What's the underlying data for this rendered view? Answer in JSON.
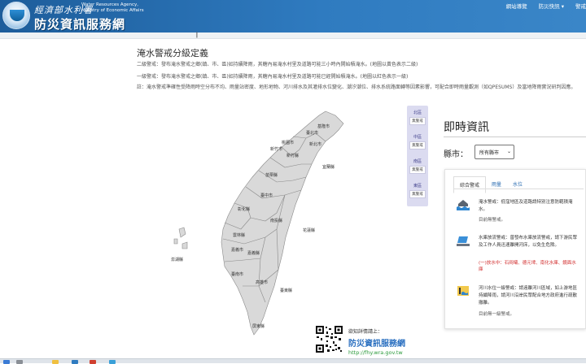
{
  "header": {
    "agency_zh": "經濟部水利署",
    "agency_en_1": "Water Resources Agency,",
    "agency_en_2": "Ministry of Economic Affairs",
    "site_title": "防災資訊服務網",
    "nav": [
      "網站導覽",
      "防災快訊 ▾",
      "警戒"
    ]
  },
  "subbar": {
    "glyph": "┃"
  },
  "definition": {
    "title": "淹水警戒分級定義",
    "level2": "二級警戒：發布淹水警戒之鄉(鎮、市、區)如持續降雨，其轄內易淹水村里及道路可能三小時內開始積淹水。(地圖以黃色表示二級)",
    "level1": "一級警戒：發布淹水警戒之鄉(鎮、市、區)如持續降雨，其轄內易淹水村里及道路可能已經開始積淹水。(地圖以紅色表示一級)",
    "note": "註：淹水警戒準確性受降雨時空分布不均、雨量站密度、地形地物、河川排水及其灌排水位變化、潮汐潮位、排水系統路面轉等因素影響，可配合即時雨量觀測（如QPESUMS）及當地降雨實況研判因應。"
  },
  "map": {
    "labels": {
      "keelung": "基隆市",
      "taipei": "臺北市",
      "newtaipei": "新北市",
      "taoyuan": "桃園市",
      "hsinchu_city": "新竹市",
      "hsinchu": "新竹縣",
      "yilan": "宜蘭縣",
      "miaoli": "苗栗縣",
      "taichung": "臺中市",
      "changhua": "彰化縣",
      "nantou": "南投縣",
      "hualien": "花蓮縣",
      "yunlin": "雲林縣",
      "chiayi_city": "嘉義市",
      "chiayi": "嘉義縣",
      "tainan": "臺南市",
      "kaohsiung": "高雄市",
      "taitung": "臺東縣",
      "pingtung": "屏東縣",
      "penghu": "澎湖縣"
    },
    "fill_color": "#d9d9d9",
    "border_color": "#8a8a8a"
  },
  "levels": [
    {
      "name": "北區",
      "state": "無警戒"
    },
    {
      "name": "中區",
      "state": "無警戒"
    },
    {
      "name": "南區",
      "state": "無警戒"
    },
    {
      "name": "東區",
      "state": "無警戒"
    }
  ],
  "realtime": {
    "title": "即時資訊",
    "county_label": "縣市：",
    "county_selected": "所有縣市",
    "tabs": [
      "綜合警戒",
      "雨量",
      "水位"
    ],
    "alerts": [
      {
        "text": "淹水警戒：低窪地區及道路請特別注意防範積淹水。",
        "status": "目前無警戒。"
      },
      {
        "text": "水庫放流警戒：曾發布水庫放流警戒，請下游民眾及工作人員迅速離開河床，以免生危險。",
        "red": "(一)放水中：石岡壩、德元埤、南化水庫、鏡面水庫"
      },
      {
        "text": "河川水位一級警戒：請遠離河川區域，如上游地區持續降雨，請河川沿岸民眾配合地方政府進行疏散撤離。",
        "status": "目前無一級警戒。"
      }
    ]
  },
  "qr": {
    "caption": "欲知詳情請上：",
    "name": "防災資訊服務網",
    "url": "http://fhy.wra.gov.tw"
  },
  "colors": {
    "header_blue": "#2f7bc0",
    "level_panel": "#dbdbf0",
    "alert_red": "#d23030",
    "link_green": "#2a9a3a"
  }
}
